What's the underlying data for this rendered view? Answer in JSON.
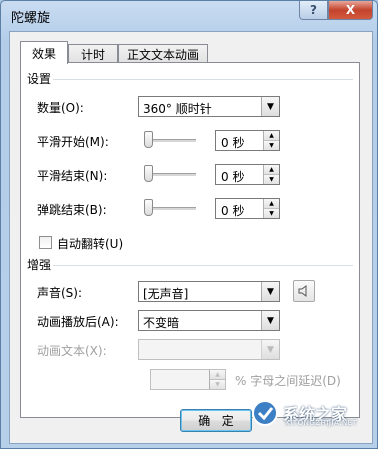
{
  "window": {
    "title": "陀螺旋",
    "help_glyph": "?",
    "close_glyph": "X"
  },
  "tabs": [
    {
      "label": "效果",
      "active": true
    },
    {
      "label": "计时",
      "active": false
    },
    {
      "label": "正文文本动画",
      "active": false
    }
  ],
  "settings": {
    "group_label": "设置",
    "amount": {
      "label": "数量(O):",
      "value": "360° 顺时针"
    },
    "smooth_start": {
      "label": "平滑开始(M):",
      "value": "0 秒"
    },
    "smooth_end": {
      "label": "平滑结束(N):",
      "value": "0 秒"
    },
    "bounce_end": {
      "label": "弹跳结束(B):",
      "value": "0 秒"
    },
    "auto_reverse": {
      "label": "自动翻转(U)",
      "checked": false
    }
  },
  "enhancements": {
    "group_label": "增强",
    "sound": {
      "label": "声音(S):",
      "value": "[无声音]"
    },
    "after_animation": {
      "label": "动画播放后(A):",
      "value": "不变暗"
    },
    "animate_text": {
      "label": "动画文本(X):",
      "value": "",
      "disabled": true
    },
    "letter_delay": {
      "value": "",
      "label": "% 字母之间延迟(D)",
      "disabled": true
    }
  },
  "buttons": {
    "ok": "确",
    "ok_tail": "定"
  },
  "watermark": {
    "text": "系统之家",
    "sub": "XITONGZHIJIA.NET"
  },
  "colors": {
    "accent": "#3c7fb1",
    "close": "#c4432c"
  }
}
